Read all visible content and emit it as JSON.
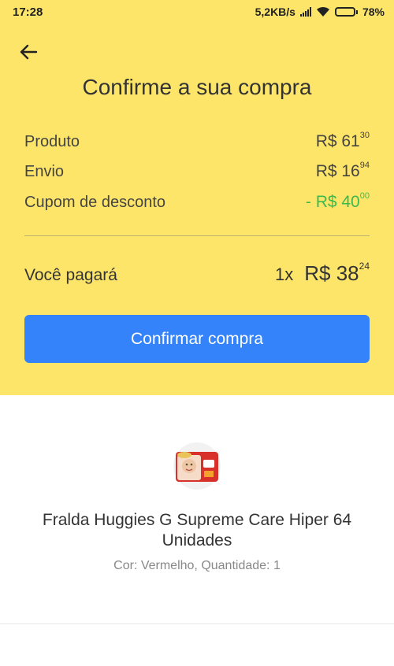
{
  "status_bar": {
    "time": "17:28",
    "network_speed": "5,2KB/s",
    "battery": "78%"
  },
  "header": {
    "back_icon": "arrow-left-icon",
    "title": "Confirme a sua compra"
  },
  "summary": {
    "product_label": "Produto",
    "product_int": "R$ 61",
    "product_cents": "30",
    "shipping_label": "Envio",
    "shipping_int": "R$ 16",
    "shipping_cents": "94",
    "coupon_label": "Cupom de desconto",
    "coupon_int": "- R$ 40",
    "coupon_cents": "00"
  },
  "total": {
    "label": "Você pagará",
    "quantity": "1x",
    "price_int": "R$ 38",
    "price_cents": "24"
  },
  "confirm_button": {
    "label": "Confirmar compra"
  },
  "product": {
    "name": "Fralda Huggies G Supreme Care Hiper 64 Unidades",
    "meta": "Cor: Vermelho, Quantidade: 1",
    "thumb_icon": "diaper-package-image"
  },
  "colors": {
    "background_yellow": "#fde569",
    "button_blue": "#3483fa",
    "discount_green": "#3db94f"
  }
}
